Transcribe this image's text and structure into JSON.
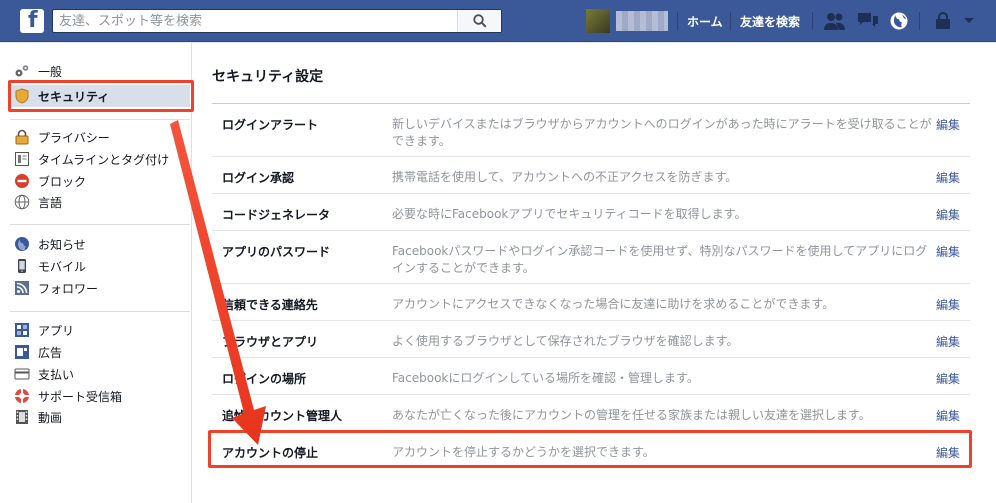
{
  "header": {
    "logo": "f",
    "search_placeholder": "友達、スポット等を検索",
    "nav_home": "ホーム",
    "nav_find_friends": "友達を検索",
    "brand_color": "#3b5998"
  },
  "sidebar": {
    "items": [
      {
        "label": "一般",
        "icon": "gears-icon"
      },
      {
        "label": "セキュリティ",
        "icon": "shield-icon"
      },
      {
        "label": "プライバシー",
        "icon": "lock-icon"
      },
      {
        "label": "タイムラインとタグ付け",
        "icon": "timeline-icon"
      },
      {
        "label": "ブロック",
        "icon": "block-icon"
      },
      {
        "label": "言語",
        "icon": "globe-icon"
      },
      {
        "label": "お知らせ",
        "icon": "notifications-globe-icon"
      },
      {
        "label": "モバイル",
        "icon": "mobile-icon"
      },
      {
        "label": "フォロワー",
        "icon": "rss-icon"
      },
      {
        "label": "アプリ",
        "icon": "apps-icon"
      },
      {
        "label": "広告",
        "icon": "ads-icon"
      },
      {
        "label": "支払い",
        "icon": "card-icon"
      },
      {
        "label": "サポート受信箱",
        "icon": "lifebuoy-icon"
      },
      {
        "label": "動画",
        "icon": "film-icon"
      }
    ]
  },
  "main": {
    "title": "セキュリティ設定",
    "edit_label": "編集",
    "rows": [
      {
        "name": "ログインアラート",
        "desc": "新しいデバイスまたはブラウザからアカウントへのログインがあった時にアラートを受け取ることができます。"
      },
      {
        "name": "ログイン承認",
        "desc": "携帯電話を使用して、アカウントへの不正アクセスを防ぎます。"
      },
      {
        "name": "コードジェネレータ",
        "desc": "必要な時にFacebookアプリでセキュリティコードを取得します。"
      },
      {
        "name": "アプリのパスワード",
        "desc": "Facebookパスワードやログイン承認コードを使用せず、特別なパスワードを使用してアプリにログインすることができます。"
      },
      {
        "name": "信頼できる連絡先",
        "desc": "アカウントにアクセスできなくなった場合に友達に助けを求めることができます。"
      },
      {
        "name": "ブラウザとアプリ",
        "desc": "よく使用するブラウザとして保存されたブラウザを確認します。"
      },
      {
        "name": "ログインの場所",
        "desc": "Facebookにログインしている場所を確認・管理します。"
      },
      {
        "name": "追悼アカウント管理人",
        "desc": "あなたが亡くなった後にアカウントの管理を任せる家族または親しい友達を選択します。"
      },
      {
        "name": "アカウントの停止",
        "desc": "アカウントを停止するかどうかを選択できます。"
      }
    ]
  },
  "annotation_color": "#f0412a"
}
